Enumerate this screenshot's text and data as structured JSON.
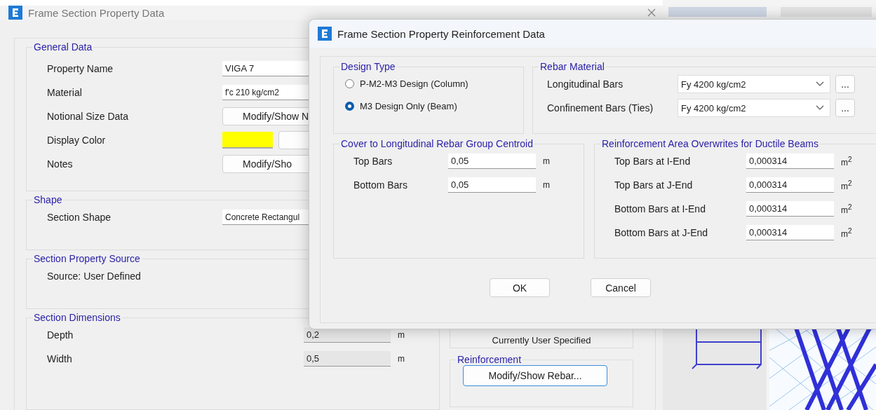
{
  "back_dialog": {
    "title": "Frame Section Property Data",
    "general": {
      "title": "General Data",
      "rows": [
        {
          "label": "Property Name",
          "kind": "text",
          "value": "VIGA 7"
        },
        {
          "label": "Material",
          "kind": "combo",
          "value": "f'c 210 kg/cm2"
        },
        {
          "label": "Notional Size Data",
          "kind": "button",
          "value": "Modify/Show N"
        },
        {
          "label": "Display Color",
          "kind": "color",
          "color": "#ffff00"
        },
        {
          "label": "Notes",
          "kind": "button",
          "value": "Modify/Sho"
        }
      ]
    },
    "shape": {
      "title": "Shape",
      "label": "Section Shape",
      "value": "Concrete Rectangul"
    },
    "source": {
      "title": "Section Property Source",
      "text": "Source:  User Defined"
    },
    "dimensions": {
      "title": "Section Dimensions",
      "rows": [
        {
          "label": "Depth",
          "value": "0,2",
          "unit": "m"
        },
        {
          "label": "Width",
          "value": "0,5",
          "unit": "m"
        }
      ]
    },
    "modifiers_text": "Currently User Specified",
    "reinforcement": {
      "title": "Reinforcement",
      "button": "Modify/Show Rebar..."
    }
  },
  "dialog": {
    "title": "Frame Section Property Reinforcement Data",
    "design_type": {
      "title": "Design Type",
      "options": [
        {
          "label": "P-M2-M3 Design  (Column)",
          "selected": false
        },
        {
          "label": "M3 Design Only  (Beam)",
          "selected": true
        }
      ]
    },
    "rebar_material": {
      "title": "Rebar Material",
      "rows": [
        {
          "label": "Longitudinal Bars",
          "value": "Fy 4200 kg/cm2",
          "more": "..."
        },
        {
          "label": "Confinement Bars (Ties)",
          "value": "Fy 4200 kg/cm2",
          "more": "..."
        }
      ]
    },
    "cover": {
      "title": "Cover to Longitudinal Rebar Group Centroid",
      "rows": [
        {
          "label": "Top Bars",
          "value": "0,05",
          "unit": "m"
        },
        {
          "label": "Bottom  Bars",
          "value": "0,05",
          "unit": "m"
        }
      ]
    },
    "area": {
      "title": "Reinforcement Area Overwrites for Ductile Beams",
      "rows": [
        {
          "label": "Top Bars at I-End",
          "value": "0,000314",
          "unit": "m$^{2}$"
        },
        {
          "label": "Top Bars at J-End",
          "value": "0,000314",
          "unit": "m$^{2}$"
        },
        {
          "label": "Bottom Bars at I-End",
          "value": "0,000314",
          "unit": "m$^{2}$"
        },
        {
          "label": "Bottom Bars at J-End",
          "value": "0,000314",
          "unit": "m$^{2}$"
        }
      ]
    },
    "buttons": [
      "OK",
      "Cancel"
    ]
  }
}
